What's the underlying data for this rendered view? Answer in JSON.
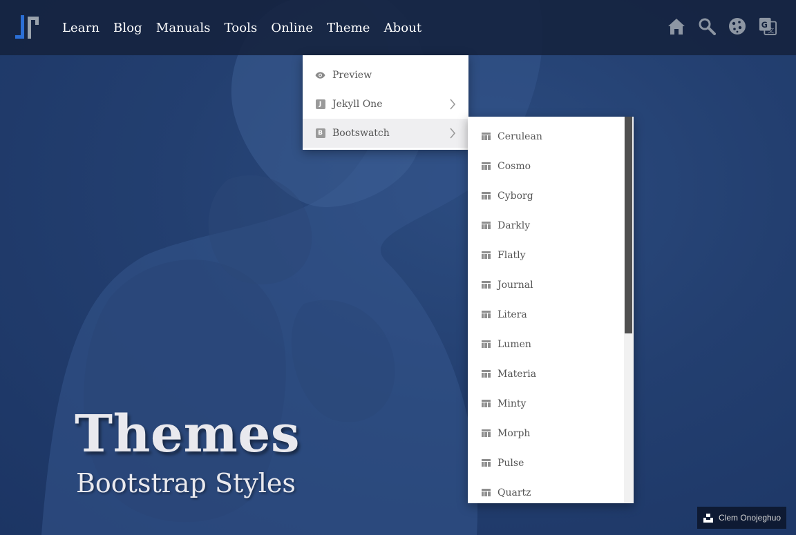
{
  "nav": {
    "links": [
      "Learn",
      "Blog",
      "Manuals",
      "Tools",
      "Online",
      "Theme",
      "About"
    ],
    "icons": [
      "home-icon",
      "search-icon",
      "cookie-icon",
      "translate-icon"
    ]
  },
  "dropdown": {
    "items": [
      {
        "label": "Preview",
        "icon": "eye-icon"
      },
      {
        "label": "Jekyll One",
        "icon": "badge-j",
        "badge": "J"
      },
      {
        "label": "Bootswatch",
        "icon": "badge-b",
        "badge": "B"
      }
    ]
  },
  "submenu": {
    "items": [
      "Cerulean",
      "Cosmo",
      "Cyborg",
      "Darkly",
      "Flatly",
      "Journal",
      "Litera",
      "Lumen",
      "Materia",
      "Minty",
      "Morph",
      "Pulse",
      "Quartz"
    ]
  },
  "hero": {
    "title": "Themes",
    "subtitle": "Bootstrap Styles"
  },
  "credit": {
    "name": "Clem Onojeghuo"
  },
  "colors": {
    "navbar": "#14223e",
    "hero": "#1f3a68",
    "logo_blue": "#2b6fd6",
    "logo_gray": "#9aa3ad",
    "icon_gray": "#8d96a3"
  }
}
